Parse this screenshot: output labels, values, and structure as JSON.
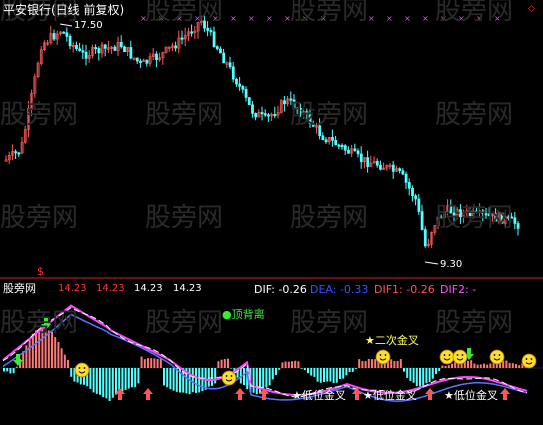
{
  "watermark": "股旁网",
  "header": {
    "title": "平安银行(日线 前复权)",
    "price_high_label": "17.50",
    "price_low_label": "9.30"
  },
  "indicator": {
    "name": "股旁网",
    "marker": "$",
    "values": [
      "14.23",
      "14.23",
      "14.23",
      "14.23"
    ],
    "dif_label": "DIF: -0.26",
    "dea_label": "DEA: -0.33",
    "dif1_label": "DIF1: -0.26",
    "dif2_label": "DIF2: -",
    "annotations": {
      "top_divergence": "●顶背离",
      "second_golden_cross": "★二次金叉",
      "low_golden_cross_1": "★低位金叉",
      "low_golden_cross_2": "★低位金叉",
      "low_golden_cross_3": "★低位金叉"
    }
  },
  "colors": {
    "background": "#000000",
    "up_candle": "#ff5c5c",
    "down_candle": "#54ffff",
    "title": "#ffffff",
    "dif": "#ffffff",
    "dea": "#3355ff",
    "dif1": "#ff5555",
    "dif2": "#ff55ff",
    "values": "#ff3333",
    "annotation_green": "#33ee33",
    "annotation_yellow": "#ffff66",
    "divider": "#cc2222"
  }
}
